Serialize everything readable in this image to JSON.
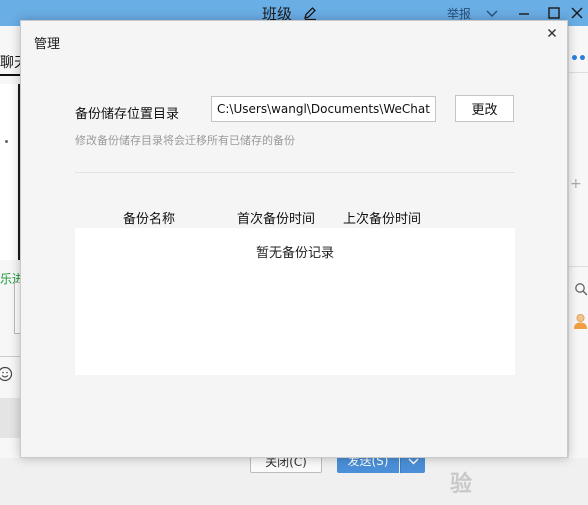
{
  "background_window": {
    "title": "班级",
    "report_label": "举报",
    "left_tab_label": "聊天",
    "left_green_text": "乐进",
    "right_more": "•••",
    "right_plus": "+",
    "close_button_label": "关闭(C)",
    "send_button_label": "发送(S)",
    "watermark_text": "Baidu 经验"
  },
  "dialog": {
    "title": "管理",
    "backup_path_label": "备份储存位置目录",
    "backup_path_value": "C:\\Users\\wangl\\Documents\\WeChat Files",
    "change_button_label": "更改",
    "hint": "修改备份储存目录将会迁移所有已储存的备份",
    "columns": [
      "备份名称",
      "首次备份时间",
      "上次备份时间"
    ],
    "empty_message": "暂无备份记录"
  },
  "colors": {
    "titlebar": "#6aaee6",
    "send_button": "#4a8fd8",
    "dialog_bg": "#f5f5f5",
    "left_green": "#1a9a3a"
  },
  "icons": {
    "edit": "pencil-icon",
    "dialog_close": "close-icon",
    "minimize": "minimize-icon",
    "maximize": "maximize-icon",
    "window_close": "close-icon",
    "dropdown": "chevron-down-icon",
    "search": "search-icon",
    "emoji": "emoji-icon",
    "avatar": "user-avatar-icon"
  }
}
